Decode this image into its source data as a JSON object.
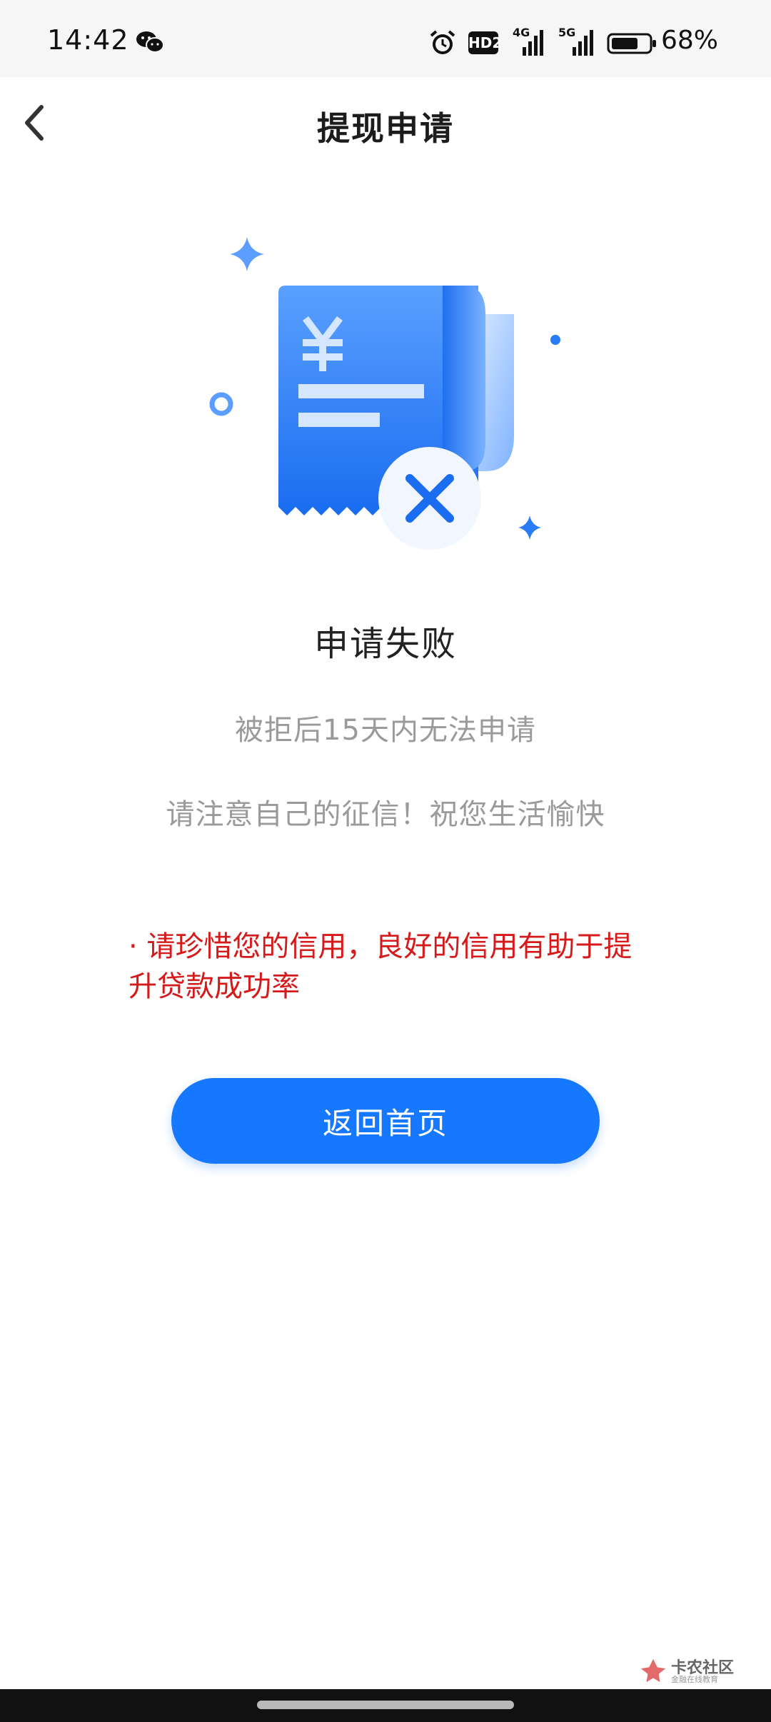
{
  "status_bar": {
    "time": "14:42",
    "hd_label": "HD2",
    "net1": "4G",
    "net2": "5G",
    "battery": "68%",
    "icons": [
      "wechat-icon",
      "alarm-icon",
      "hd-icon",
      "signal-4g-icon",
      "signal-5g-icon",
      "battery-icon"
    ]
  },
  "nav": {
    "title": "提现申请",
    "back_icon": "chevron-left-icon"
  },
  "result": {
    "title": "申请失败",
    "line1": "被拒后15天内无法申请",
    "line2": "请注意自己的征信！祝您生活愉快",
    "warning": "· 请珍惜您的信用，良好的信用有助于提升贷款成功率"
  },
  "actions": {
    "home_label": "返回首页"
  },
  "watermark": {
    "main": "卡农社区",
    "sub": "金融在线教育"
  },
  "colors": {
    "primary": "#1677ff",
    "warning": "#d41a1a",
    "muted_text": "#9a9a9a"
  }
}
